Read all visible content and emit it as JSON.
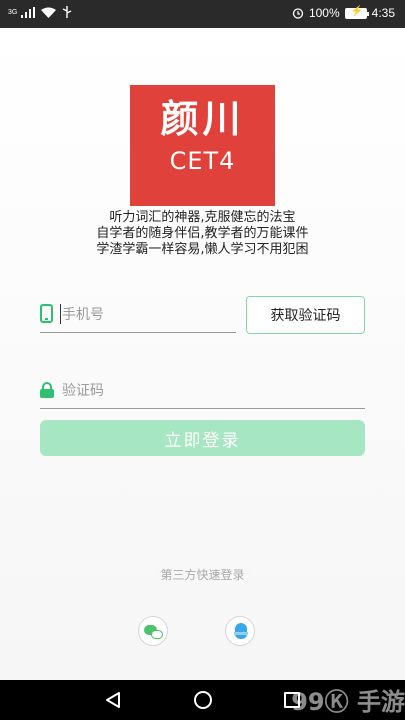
{
  "status_bar": {
    "network": "3G",
    "battery": "100%",
    "time": "4:35"
  },
  "logo": {
    "title": "颜川",
    "subtitle": "CET4"
  },
  "slogan": {
    "line1": "听力词汇的神器,克服健忘的法宝",
    "line2": "自学者的随身伴侣,教学者的万能课件",
    "line3": "学渣学霸一样容易,懒人学习不用犯困"
  },
  "form": {
    "phone_placeholder": "手机号",
    "sms_button_label": "获取验证码",
    "code_placeholder": "验证码",
    "login_button_label": "立即登录"
  },
  "third_party": {
    "label": "第三方快速登录",
    "providers": [
      "wechat-icon",
      "qq-icon"
    ]
  },
  "nav_bar": {
    "watermark": "99Ⓚ 手游"
  },
  "colors": {
    "brand_red": "#e0413b",
    "accent_green": "#2fbf71",
    "login_disabled": "#a6e6c3"
  }
}
